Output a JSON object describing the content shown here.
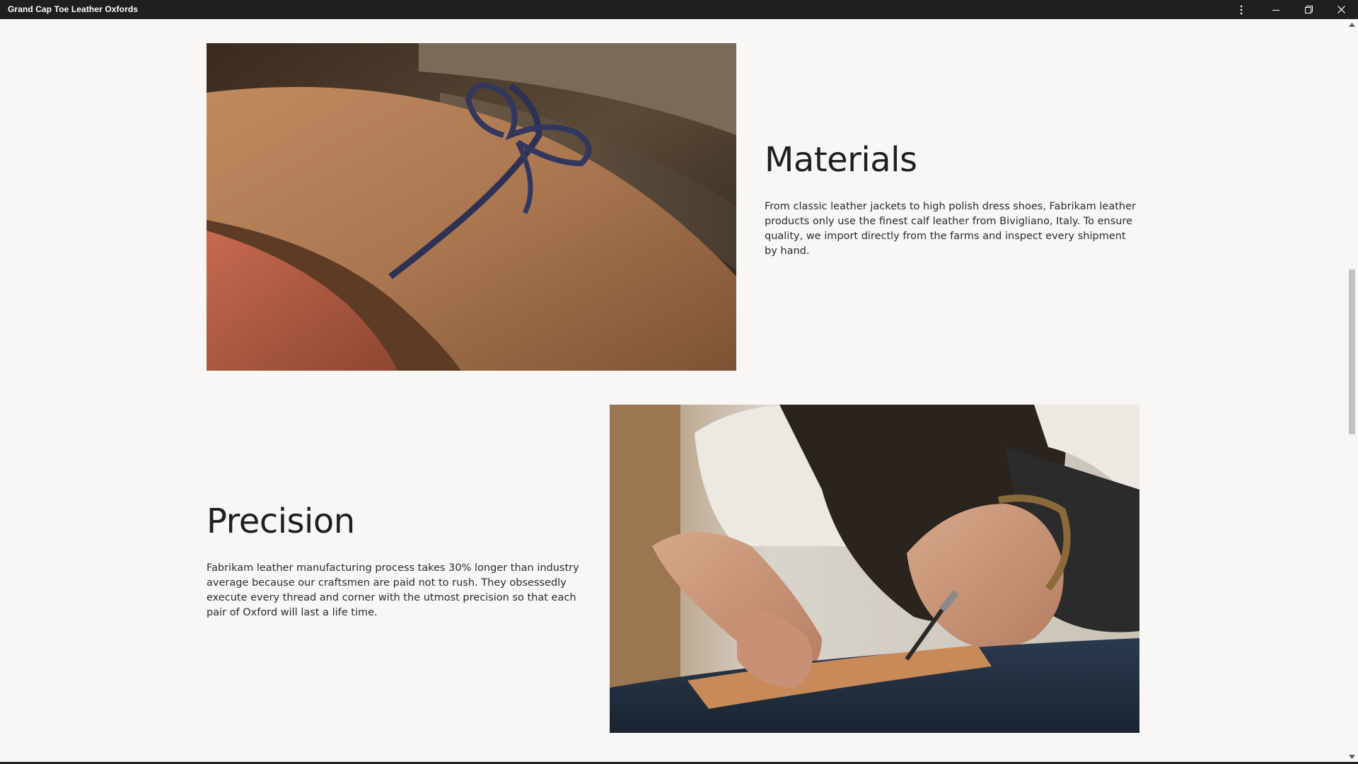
{
  "window": {
    "title": "Grand Cap Toe Leather Oxfords",
    "buttons": [
      "more-icon",
      "minimize-icon",
      "restore-icon",
      "close-icon"
    ]
  },
  "sections": {
    "materials": {
      "heading": "Materials",
      "body": "From classic leather jackets to high polish dress shoes, Fabrikam leather products only use the finest calf leather from Bivigliano, Italy. To ensure quality, we import directly from the farms and inspect every shipment by hand.",
      "image": "rolled-suede-leather-with-blue-cord"
    },
    "precision": {
      "heading": "Precision",
      "body": "Fabrikam leather manufacturing process takes 30% longer than industry average because our craftsmen are paid not to rush. They obsessedly execute every thread and corner with the utmost precision so that each pair of Oxford will last a life time.",
      "image": "craftsman-cutting-leather"
    }
  },
  "colors": {
    "background": "#f8f7f6",
    "titlebar": "#1f1f1f",
    "text": "#1f1f1f"
  }
}
